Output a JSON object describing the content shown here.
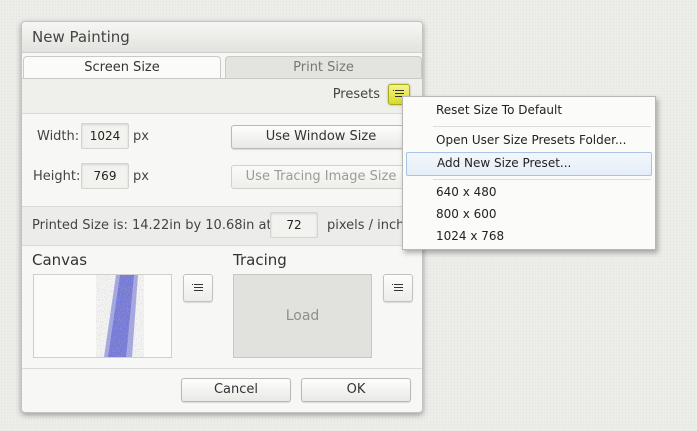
{
  "dialog": {
    "title": "New Painting",
    "tabs": [
      {
        "label": "Screen Size",
        "active": true
      },
      {
        "label": "Print Size",
        "active": false
      }
    ],
    "presets_label": "Presets",
    "width": {
      "label": "Width:",
      "value": "1024",
      "unit": "px"
    },
    "height": {
      "label": "Height:",
      "value": "769",
      "unit": "px"
    },
    "use_window_size_label": "Use Window Size",
    "use_tracing_size_label": "Use Tracing Image Size",
    "printed": {
      "prefix": "Printed Size is:  14.22in by 10.68in at:",
      "dpi": "72",
      "suffix": "pixels / inch."
    },
    "canvas_label": "Canvas",
    "tracing_label": "Tracing",
    "load_label": "Load",
    "cancel_label": "Cancel",
    "ok_label": "OK"
  },
  "presets_menu": {
    "items": [
      "Reset Size To Default",
      "Open User Size Presets Folder...",
      "Add New Size Preset...",
      "640 x 480",
      "800 x 600",
      "1024 x 768"
    ],
    "highlighted": "Add New Size Preset..."
  },
  "colors": {
    "presets_button": "#e3e542",
    "menu_highlight": "#e4edf8",
    "canvas_stroke": "#3b3fcf"
  }
}
